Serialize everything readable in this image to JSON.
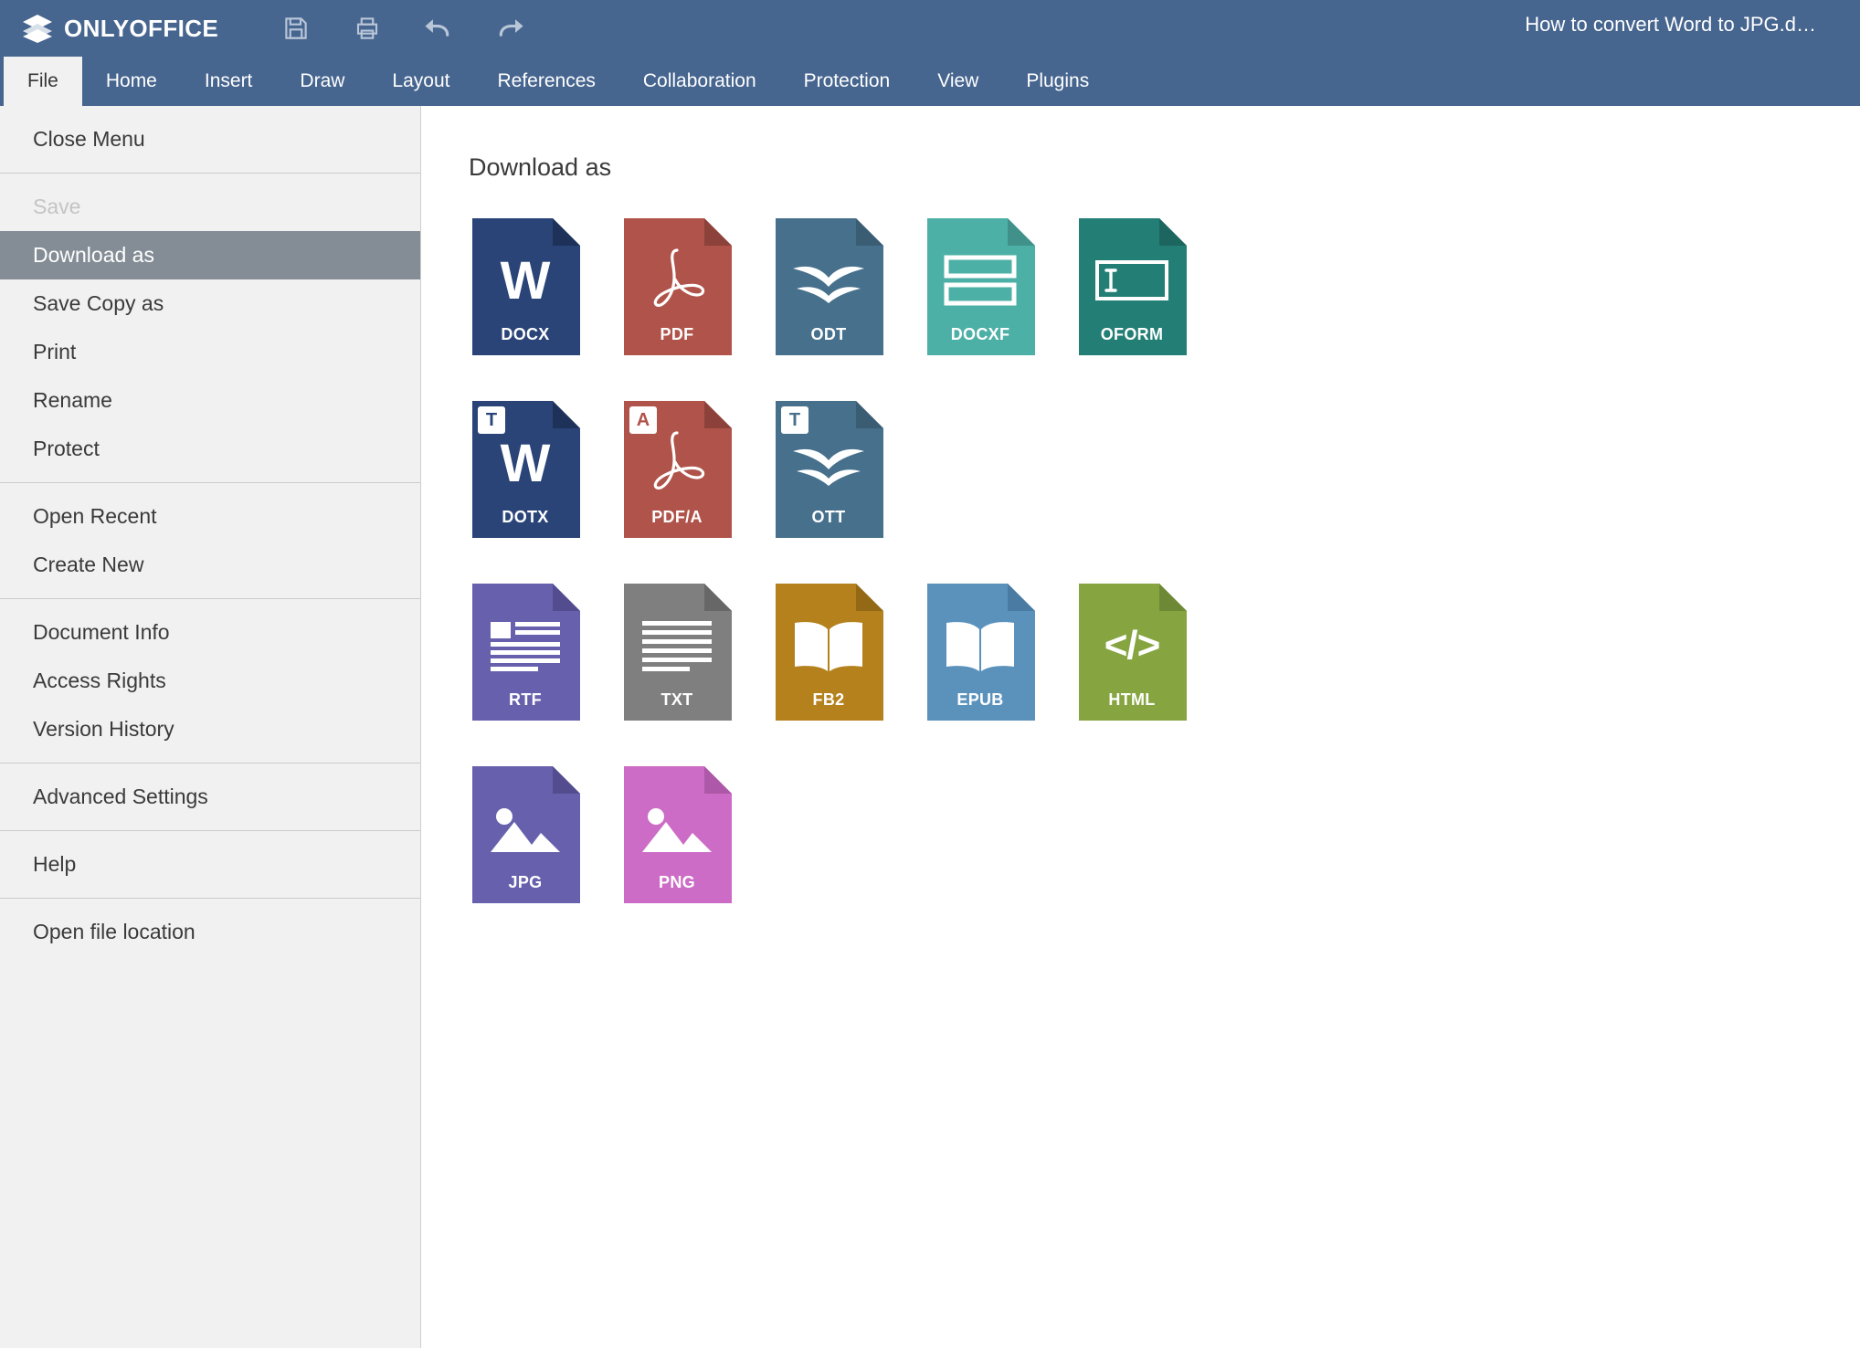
{
  "app": {
    "brand": "ONLYOFFICE",
    "document_title": "How to convert Word to JPG.d…"
  },
  "quick_access": [
    {
      "name": "save-icon",
      "label": "Save"
    },
    {
      "name": "print-icon",
      "label": "Print"
    },
    {
      "name": "undo-icon",
      "label": "Undo"
    },
    {
      "name": "redo-icon",
      "label": "Redo"
    }
  ],
  "tabs": [
    {
      "label": "File",
      "active": true
    },
    {
      "label": "Home",
      "active": false
    },
    {
      "label": "Insert",
      "active": false
    },
    {
      "label": "Draw",
      "active": false
    },
    {
      "label": "Layout",
      "active": false
    },
    {
      "label": "References",
      "active": false
    },
    {
      "label": "Collaboration",
      "active": false
    },
    {
      "label": "Protection",
      "active": false
    },
    {
      "label": "View",
      "active": false
    },
    {
      "label": "Plugins",
      "active": false
    }
  ],
  "sidebar": {
    "groups": [
      {
        "items": [
          {
            "label": "Close Menu",
            "state": "normal"
          }
        ]
      },
      {
        "items": [
          {
            "label": "Save",
            "state": "disabled"
          },
          {
            "label": "Download as",
            "state": "active"
          },
          {
            "label": "Save Copy as",
            "state": "normal"
          },
          {
            "label": "Print",
            "state": "normal"
          },
          {
            "label": "Rename",
            "state": "normal"
          },
          {
            "label": "Protect",
            "state": "normal"
          }
        ]
      },
      {
        "items": [
          {
            "label": "Open Recent",
            "state": "normal"
          },
          {
            "label": "Create New",
            "state": "normal"
          }
        ]
      },
      {
        "items": [
          {
            "label": "Document Info",
            "state": "normal"
          },
          {
            "label": "Access Rights",
            "state": "normal"
          },
          {
            "label": "Version History",
            "state": "normal"
          }
        ]
      },
      {
        "items": [
          {
            "label": "Advanced Settings",
            "state": "normal"
          }
        ]
      },
      {
        "items": [
          {
            "label": "Help",
            "state": "normal"
          }
        ]
      },
      {
        "items": [
          {
            "label": "Open file location",
            "state": "normal"
          }
        ]
      }
    ]
  },
  "main": {
    "heading": "Download as",
    "rows": [
      [
        {
          "label": "DOCX",
          "color": "#2a4478",
          "fold": "#1d3159",
          "glyph": "w-letter",
          "badge": null
        },
        {
          "label": "PDF",
          "color": "#b0534a",
          "fold": "#8c423b",
          "glyph": "acrobat",
          "badge": null
        },
        {
          "label": "ODT",
          "color": "#46708c",
          "fold": "#3a5d74",
          "glyph": "gull",
          "badge": null
        },
        {
          "label": "DOCXF",
          "color": "#4db0a6",
          "fold": "#3f9189",
          "glyph": "form-bars",
          "badge": null
        },
        {
          "label": "OFORM",
          "color": "#237f76",
          "fold": "#1c665f",
          "glyph": "form-field",
          "badge": null
        }
      ],
      [
        {
          "label": "DOTX",
          "color": "#2a4478",
          "fold": "#1d3159",
          "glyph": "w-letter",
          "badge": {
            "text": "T",
            "color": "#2a4478"
          }
        },
        {
          "label": "PDF/A",
          "color": "#b0534a",
          "fold": "#8c423b",
          "glyph": "acrobat",
          "badge": {
            "text": "A",
            "color": "#b0534a"
          }
        },
        {
          "label": "OTT",
          "color": "#46708c",
          "fold": "#3a5d74",
          "glyph": "gull",
          "badge": {
            "text": "T",
            "color": "#46708c"
          }
        }
      ],
      [
        {
          "label": "RTF",
          "color": "#6760ad",
          "fold": "#534d90",
          "glyph": "rtf-lines",
          "badge": null
        },
        {
          "label": "TXT",
          "color": "#7f7f7f",
          "fold": "#676767",
          "glyph": "txt-lines",
          "badge": null
        },
        {
          "label": "FB2",
          "color": "#b4811d",
          "fold": "#946916",
          "glyph": "book",
          "badge": null
        },
        {
          "label": "EPUB",
          "color": "#5b92bc",
          "fold": "#4a7ba2",
          "glyph": "book",
          "badge": null
        },
        {
          "label": "HTML",
          "color": "#86a541",
          "fold": "#6e8936",
          "glyph": "code-tags",
          "badge": null
        }
      ],
      [
        {
          "label": "JPG",
          "color": "#6760ad",
          "fold": "#534d90",
          "glyph": "image",
          "badge": null
        },
        {
          "label": "PNG",
          "color": "#cc6cc6",
          "fold": "#ad58a8",
          "glyph": "image",
          "badge": null
        }
      ]
    ]
  },
  "colors": {
    "chrome": "#46658f",
    "sidebar_bg": "#f1f1f1",
    "sidebar_active": "#848d95",
    "content_bg": "#ffffff"
  }
}
